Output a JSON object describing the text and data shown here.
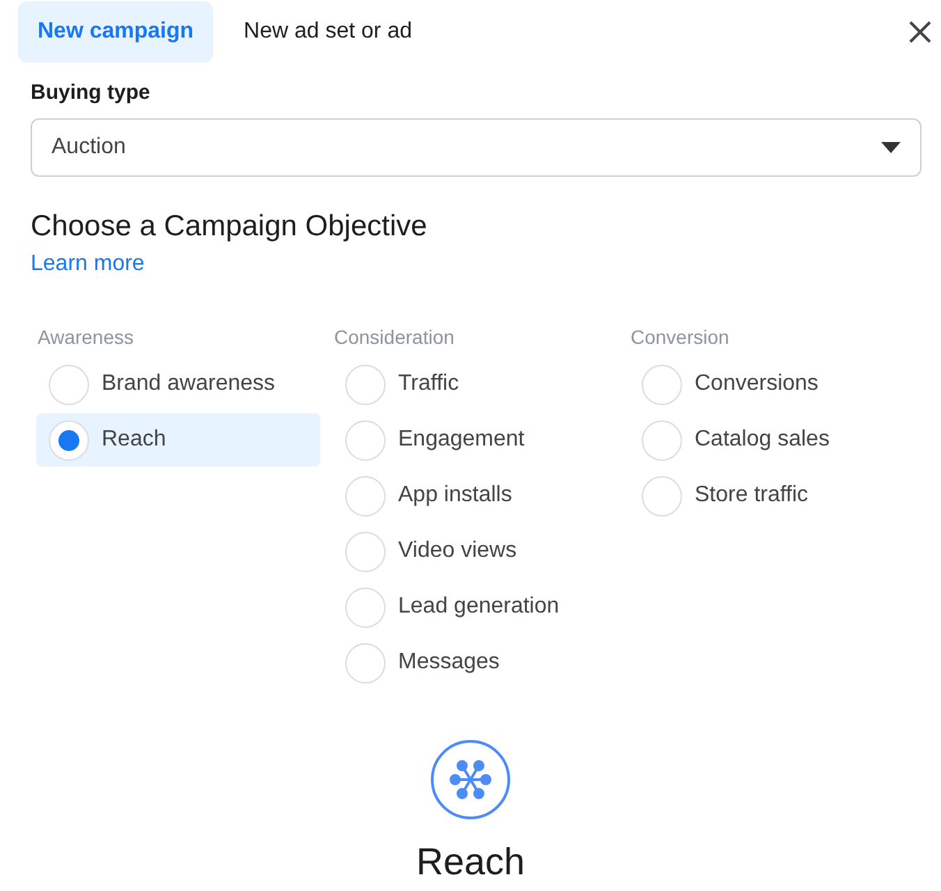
{
  "tabs": [
    {
      "label": "New campaign",
      "selected": true
    },
    {
      "label": "New ad set or ad",
      "selected": false
    }
  ],
  "buying_type": {
    "label": "Buying type",
    "value": "Auction"
  },
  "objective": {
    "title": "Choose a Campaign Objective",
    "link": "Learn more"
  },
  "columns": [
    {
      "heading": "Awareness",
      "options": [
        {
          "label": "Brand awareness",
          "selected": false
        },
        {
          "label": "Reach",
          "selected": true
        }
      ]
    },
    {
      "heading": "Consideration",
      "options": [
        {
          "label": "Traffic",
          "selected": false
        },
        {
          "label": "Engagement",
          "selected": false
        },
        {
          "label": "App installs",
          "selected": false
        },
        {
          "label": "Video views",
          "selected": false
        },
        {
          "label": "Lead generation",
          "selected": false
        },
        {
          "label": "Messages",
          "selected": false
        }
      ]
    },
    {
      "heading": "Conversion",
      "options": [
        {
          "label": "Conversions",
          "selected": false
        },
        {
          "label": "Catalog sales",
          "selected": false
        },
        {
          "label": "Store traffic",
          "selected": false
        }
      ]
    }
  ],
  "preview": {
    "title": "Reach"
  }
}
